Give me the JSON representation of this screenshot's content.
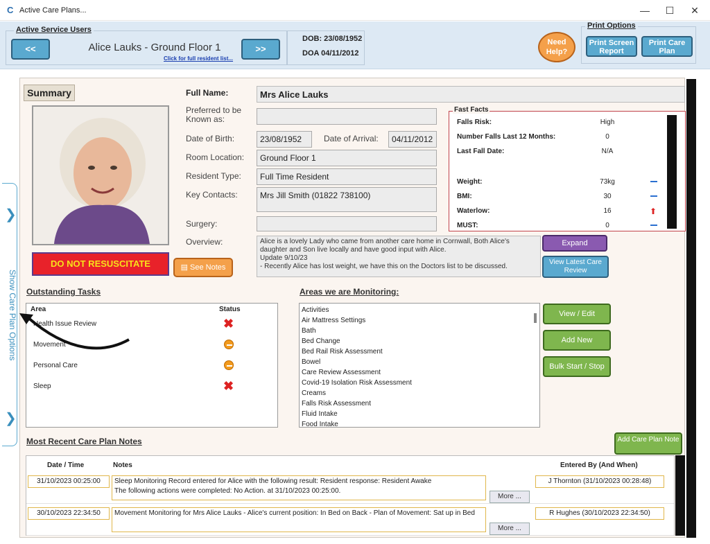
{
  "window": {
    "title": "Active Care Plans...",
    "minimize": "—",
    "maximize": "☐",
    "close": "✕"
  },
  "header": {
    "active_service_users_label": "Active Service Users",
    "prev_label": "<<",
    "next_label": ">>",
    "resident_name": "Alice Lauks - Ground Floor 1",
    "resident_list_link": "Click for full resident list...",
    "dob": "DOB: 23/08/1952",
    "doa": "DOA 04/11/2012",
    "need_help": "Need Help?",
    "print_options_label": "Print Options",
    "print_screen_report": "Print Screen Report",
    "print_care_plan": "Print Care Plan"
  },
  "side_tab": {
    "label": "Show Care Plan Options"
  },
  "summary": {
    "tag": "Summary",
    "full_name_label": "Full Name:",
    "full_name": "Mrs Alice Lauks",
    "preferred_label": "Preferred to be Known as:",
    "preferred": "",
    "dob_label": "Date of Birth:",
    "dob": "23/08/1952",
    "doa_label": "Date of Arrival:",
    "doa": "04/11/2012",
    "room_label": "Room Location:",
    "room": "Ground Floor 1",
    "type_label": "Resident Type:",
    "type": "Full Time Resident",
    "contacts_label": "Key Contacts:",
    "contacts": "Mrs Jill Smith (01822 738100)",
    "surgery_label": "Surgery:",
    "surgery": "",
    "overview_label": "Overview:",
    "overview": "Alice is a lovely Lady who came from another care home in Cornwall, Both Alice's daughter and Son live locally and have good input with Alice.\nUpdate 9/10/23\n- Recently Alice has lost weight, we have this on the Doctors list to be discussed.",
    "dnr": "DO NOT RESUSCITATE",
    "see_notes": "See Notes",
    "expand": "Expand",
    "view_latest": "View Latest Care Review"
  },
  "fast_facts": {
    "title": "Fast Facts",
    "rows": [
      {
        "label": "Falls Risk:",
        "value": "High",
        "trend": ""
      },
      {
        "label": "Number Falls Last 12 Months:",
        "value": "0",
        "trend": ""
      },
      {
        "label": "Last Fall Date:",
        "value": "N/A",
        "trend": ""
      },
      {
        "label": "Weight:",
        "value": "73kg",
        "trend": "--"
      },
      {
        "label": "BMI:",
        "value": "30",
        "trend": "--"
      },
      {
        "label": "Waterlow:",
        "value": "16",
        "trend": "up"
      },
      {
        "label": "MUST:",
        "value": "0",
        "trend": "--"
      }
    ]
  },
  "tasks": {
    "title": "Outstanding Tasks",
    "col_area": "Area",
    "col_status": "Status",
    "items": [
      {
        "area": "Health Issue Review",
        "status": "x"
      },
      {
        "area": "Movement",
        "status": "dash"
      },
      {
        "area": "Personal Care",
        "status": "dash"
      },
      {
        "area": "Sleep",
        "status": "x"
      }
    ]
  },
  "monitoring": {
    "title": "Areas we are Monitoring:",
    "items": [
      "Activities",
      "Air Mattress Settings",
      "Bath",
      "Bed Change",
      "Bed Rail Risk Assessment",
      "Bowel",
      "Care Review Assessment",
      "Covid-19 Isolation Risk Assessment",
      "Creams",
      "Falls Risk Assessment",
      "Fluid Intake",
      "Food Intake"
    ],
    "view_edit": "View / Edit",
    "add_new": "Add New",
    "bulk": "Bulk Start / Stop"
  },
  "notes": {
    "title": "Most Recent Care Plan Notes",
    "add_note": "Add Care Plan Note",
    "col_date": "Date / Time",
    "col_notes": "Notes",
    "col_by": "Entered By (And When)",
    "more": "More ...",
    "rows": [
      {
        "date": "31/10/2023 00:25:00",
        "text": "Sleep Monitoring Record entered for Alice with the following result: Resident response: Resident Awake\nThe following actions were completed:  No Action. at 31/10/2023 00:25:00.",
        "by": "J Thornton (31/10/2023 00:28:48)"
      },
      {
        "date": "30/10/2023 22:34:50",
        "text": "Movement Monitoring for Mrs Alice Lauks - Alice's current position: In Bed on Back - Plan of Movement: Sat up in Bed",
        "by": "R Hughes (30/10/2023 22:34:50)"
      }
    ]
  }
}
